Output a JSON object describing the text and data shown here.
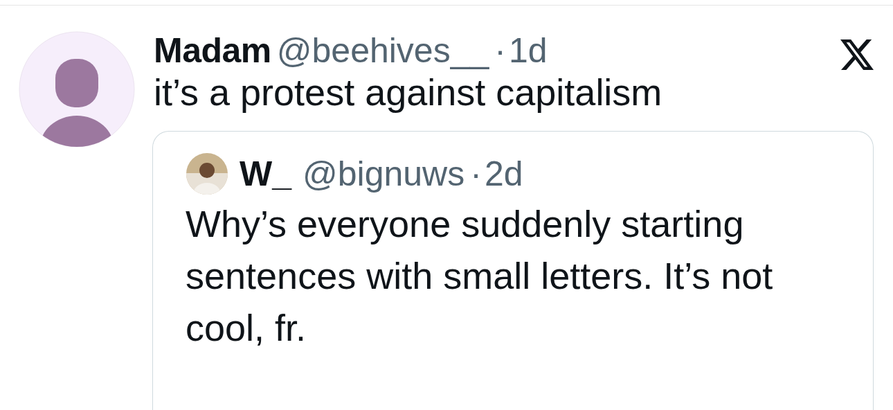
{
  "tweet": {
    "name": "Madam",
    "handle": "@beehives__",
    "separator": "·",
    "time": "1d",
    "text": "it’s a protest against capitalism",
    "quote": {
      "name": "W_",
      "handle": "@bignuws",
      "separator": "·",
      "time": "2d",
      "text": "Why’s everyone suddenly starting sentences with small letters. It’s not cool, fr."
    }
  }
}
